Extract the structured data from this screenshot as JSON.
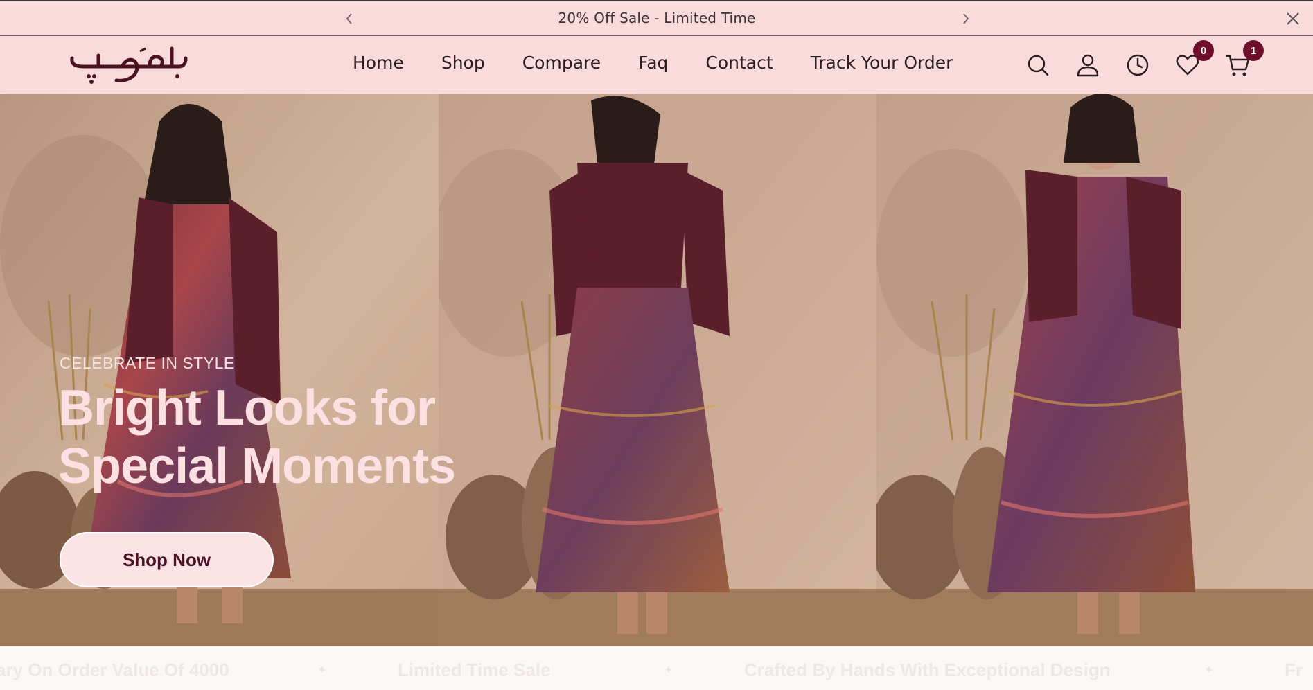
{
  "announcement": {
    "message": "20% Off Sale - Limited Time",
    "prev_icon": "chevron-left-icon",
    "next_icon": "chevron-right-icon",
    "close_icon": "close-icon"
  },
  "header": {
    "logo_text": "بہروپ",
    "nav": [
      "Home",
      "Shop",
      "Compare",
      "Faq",
      "Contact",
      "Track Your Order"
    ],
    "icons": {
      "search": "search-icon",
      "account": "user-icon",
      "recent": "clock-icon",
      "wishlist": "heart-icon",
      "cart": "cart-icon"
    },
    "wishlist_count": "0",
    "cart_count": "1"
  },
  "hero": {
    "kicker": "CELEBRATE IN STYLE",
    "headline_line1": "Bright Looks for",
    "headline_line2": "Special Moments",
    "cta": "Shop Now"
  },
  "marquee": {
    "items": [
      "ary On Order Value Of 4000",
      "Limited Time Sale",
      "Crafted By Hands With Exceptional Design",
      "Fr"
    ]
  },
  "colors": {
    "announcement_bg": "#fadbdb",
    "header_bg": "#fadbdb",
    "badge": "#6e0f2c",
    "headline": "#fde0e1",
    "cta_text": "#4a1226"
  }
}
